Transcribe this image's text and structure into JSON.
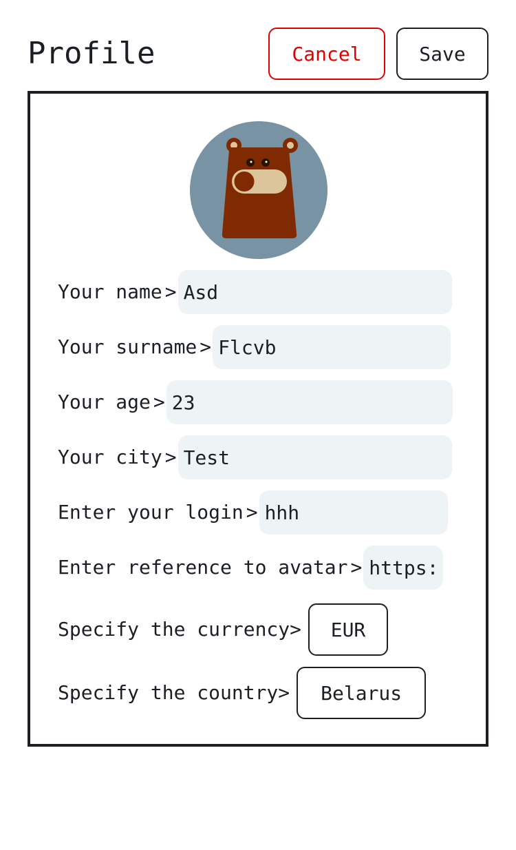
{
  "header": {
    "title": "Profile",
    "cancel_label": "Cancel",
    "save_label": "Save"
  },
  "avatar": {
    "icon": "bear-avatar",
    "background": "#7893a3"
  },
  "form": {
    "chevron": ">",
    "fields": [
      {
        "label": "Your name",
        "value": "Asd"
      },
      {
        "label": "Your surname",
        "value": "Flcvb"
      },
      {
        "label": "Your age",
        "value": "23"
      },
      {
        "label": "Your city",
        "value": "Test"
      },
      {
        "label": "Enter your login",
        "value": "hhh"
      },
      {
        "label": "Enter reference to avatar",
        "value": "https:"
      }
    ],
    "currency": {
      "label": "Specify the currency",
      "value": "EUR"
    },
    "country": {
      "label": "Specify the country",
      "value": "Belarus"
    }
  },
  "colors": {
    "cancel": "#e00000",
    "border": "#1b1f24",
    "field_bg": "#eef3f6"
  }
}
